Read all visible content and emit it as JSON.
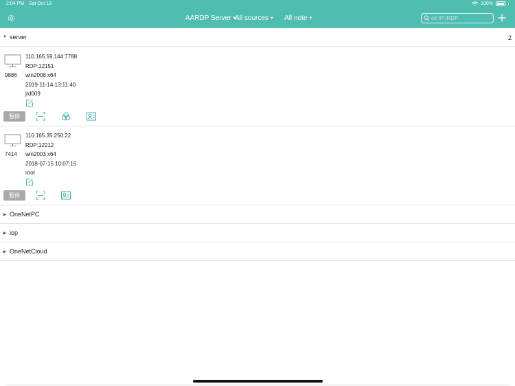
{
  "status_bar": {
    "time": "2:04 PM",
    "date": "Sat Oct 19",
    "battery": "100%"
  },
  "toolbar": {
    "server_menu": "AARDP Server",
    "sources_menu": "All sources",
    "note_menu": "All note",
    "search_placeholder": "ct/ IP /RDP"
  },
  "groups": [
    {
      "name": "server",
      "count": "2",
      "expanded": true,
      "entries": [
        {
          "id": "9886",
          "address": "110.165.59.144:7788",
          "rdp": "RDP:12151",
          "os": "win2008 x64",
          "datetime": "2019-11-14 13:11:40",
          "user": "jtd009",
          "pause_label": "暂停"
        },
        {
          "id": "7414",
          "address": "110.165.35.250:22",
          "rdp": "RDP:12212",
          "os": "win2003 x64",
          "datetime": "2018-07-15 10:07:15",
          "user": "root",
          "pause_label": "暂停"
        }
      ]
    },
    {
      "name": "OneNetPC",
      "expanded": false
    },
    {
      "name": "iop",
      "expanded": false
    },
    {
      "name": "OneNetCloud",
      "expanded": false
    }
  ],
  "colors": {
    "accent": "#4fbdb0",
    "icon_teal": "#3fb3a8",
    "pause_button": "#a9a9a9"
  },
  "icons": [
    "gear-icon",
    "plus-icon",
    "search-icon",
    "monitor-icon",
    "edit-icon",
    "fullscreen-icon",
    "link-icon",
    "user-card-icon",
    "wifi-icon",
    "battery-icon"
  ]
}
